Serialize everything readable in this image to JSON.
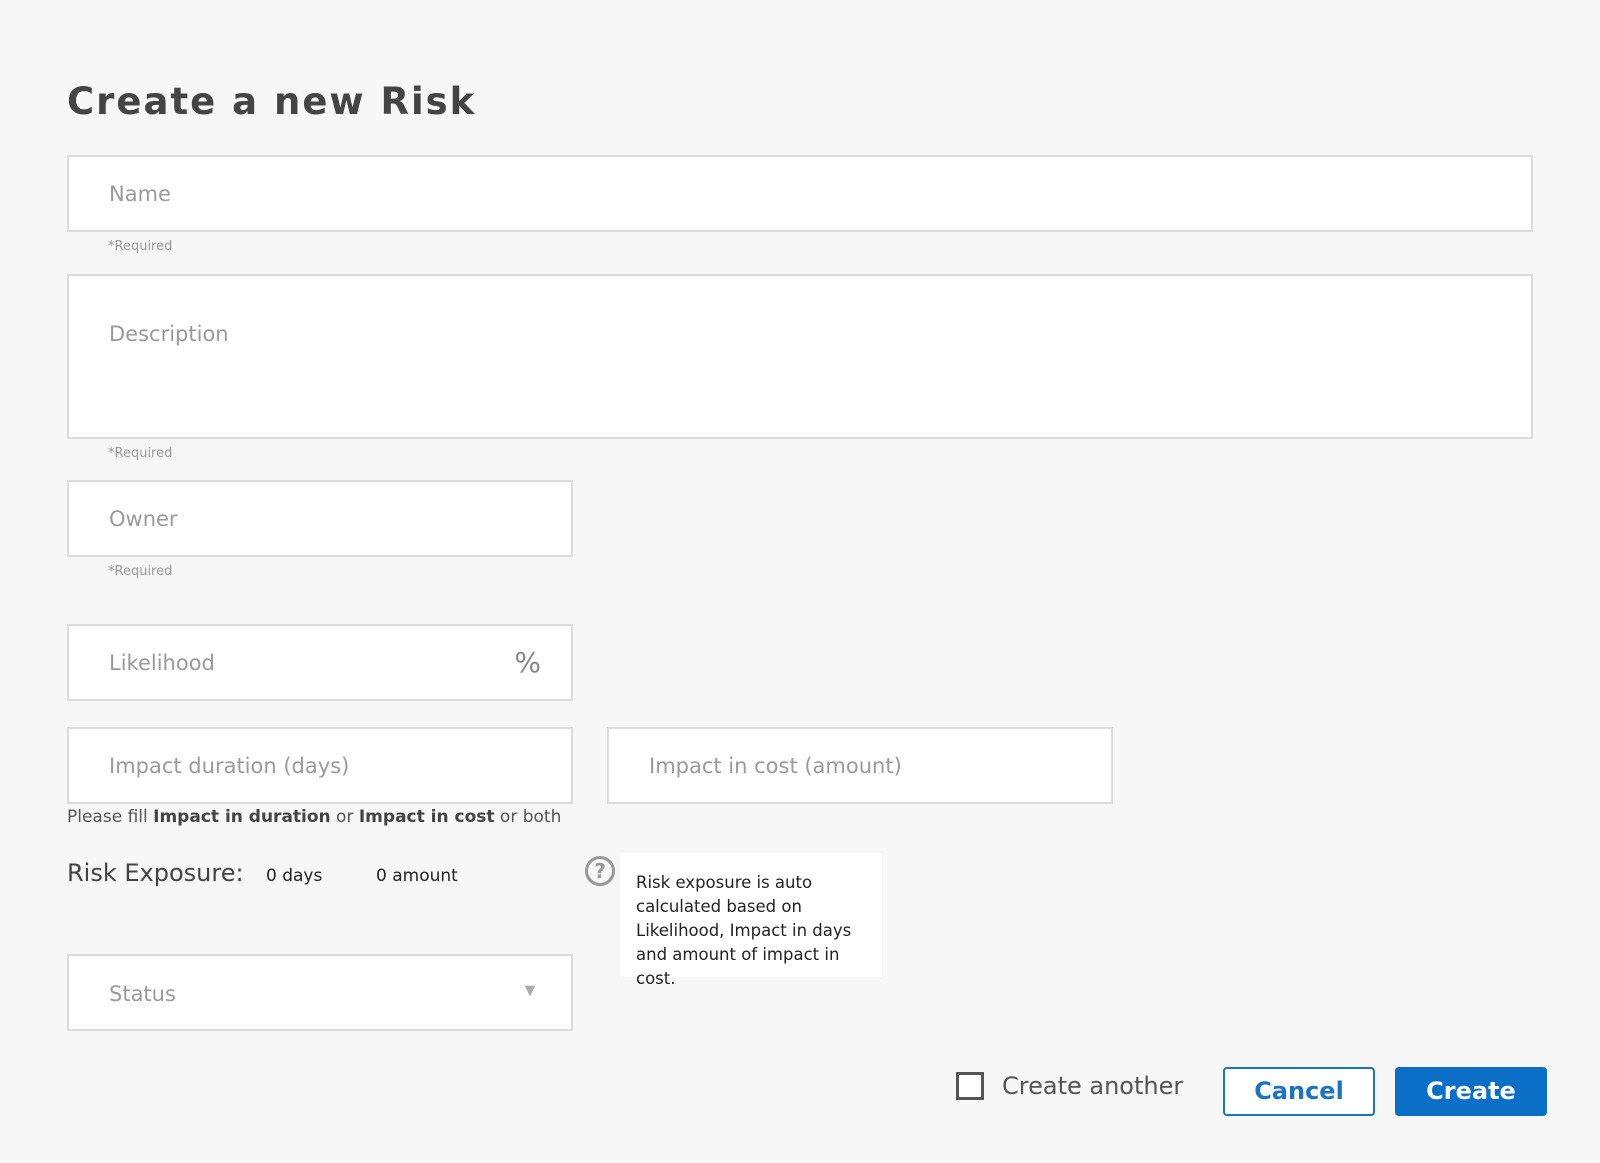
{
  "title": "Create a new Risk",
  "fields": {
    "name": {
      "placeholder": "Name",
      "hint": "*Required"
    },
    "description": {
      "placeholder": "Description",
      "hint": "*Required"
    },
    "owner": {
      "placeholder": "Owner",
      "hint": "*Required"
    },
    "likelihood": {
      "placeholder": "Likelihood",
      "suffix": "%"
    },
    "impact_duration": {
      "placeholder": "Impact duration (days)"
    },
    "impact_cost": {
      "placeholder": "Impact in cost (amount)"
    },
    "status": {
      "placeholder": "Status",
      "arrow": "▼"
    }
  },
  "impact_note": {
    "prefix": "Please fill ",
    "duration": "Impact in duration",
    "or": " or ",
    "cost": "Impact in cost",
    "suffix": " or both"
  },
  "exposure": {
    "label": "Risk Exposure:",
    "days": "0 days",
    "amount": "0 amount",
    "help_icon": "?",
    "tooltip": "Risk exposure is auto calculated based on Likelihood, Impact in days and amount of impact in cost."
  },
  "footer": {
    "create_another_label": "Create another",
    "create_another_checked": false,
    "cancel_label": "Cancel",
    "create_label": "Create"
  },
  "colors": {
    "accent": "#0b6fc7",
    "background": "#f7f7f7"
  }
}
